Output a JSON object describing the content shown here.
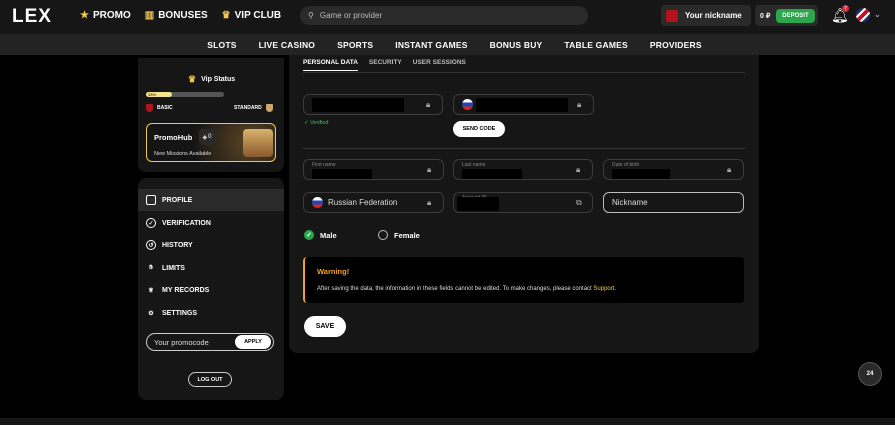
{
  "header": {
    "logo": "LEX",
    "nav": [
      {
        "label": "PROMO",
        "icon": "star-icon"
      },
      {
        "label": "BONUSES",
        "icon": "gift-icon"
      },
      {
        "label": "VIP CLUB",
        "icon": "crown-icon"
      }
    ],
    "search_placeholder": "Game or provider",
    "nickname": "Your nickname",
    "balance": "0 ₽",
    "deposit": "DEPOSIT",
    "notifications_count": "7"
  },
  "categories": [
    "SLOTS",
    "LIVE CASINO",
    "SPORTS",
    "INSTANT GAMES",
    "BONUS BUY",
    "TABLE GAMES",
    "PROVIDERS"
  ],
  "vip": {
    "title": "Vip Status",
    "progress": "33%",
    "progress_value": 0.33,
    "current": "BASIC",
    "next": "STANDARD"
  },
  "promohub": {
    "title": "PromoHub",
    "count": "0",
    "subtitle": "New Missions Available"
  },
  "menu": [
    {
      "label": "PROFILE",
      "icon": "profile-icon",
      "active": true
    },
    {
      "label": "VERIFICATION",
      "icon": "verification-icon"
    },
    {
      "label": "HISTORY",
      "icon": "history-icon"
    },
    {
      "label": "LIMITS",
      "icon": "hand-icon"
    },
    {
      "label": "MY RECORDS",
      "icon": "trophy-icon"
    },
    {
      "label": "SETTINGS",
      "icon": "gear-icon"
    }
  ],
  "promocode": {
    "placeholder": "Your promocode",
    "apply": "APPLY"
  },
  "logout": "LOG OUT",
  "tabs": [
    "PERSONAL DATA",
    "SECURITY",
    "USER SESSIONS"
  ],
  "form": {
    "verified": "Verified",
    "send_code": "SEND CODE",
    "first_name_label": "First name",
    "last_name_label": "Last name",
    "dob_label": "Date of birth",
    "country": "Russian Federation",
    "account_id_label": "Account ID",
    "nickname_placeholder": "Nickname",
    "gender_male": "Male",
    "gender_female": "Female",
    "warning_title": "Warning!",
    "warning_text": "After saving the data, the information in these fields cannot be edited. To make changes, please contact ",
    "warning_link": "Support",
    "save": "SAVE"
  },
  "support_badge": "24"
}
